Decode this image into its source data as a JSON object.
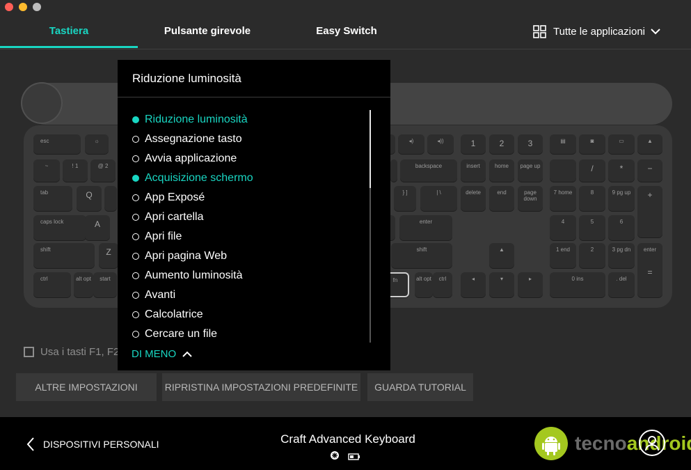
{
  "tabs": [
    {
      "label": "Tastiera"
    },
    {
      "label": "Pulsante girevole"
    },
    {
      "label": "Easy Switch"
    }
  ],
  "apps_label": "Tutte le applicazioni",
  "keys": {
    "esc": "esc",
    "backspace": "backspace",
    "insert": "insert",
    "home": "home",
    "pageup": "page up",
    "delete": "delete",
    "end": "end",
    "pagedown": "page down",
    "tab": "tab",
    "capslock": "caps lock",
    "shift_l": "shift",
    "shift_r": "shift",
    "enter": "enter",
    "ctrl_l": "ctrl",
    "ctrl_r": "ctrl",
    "alt": "alt opt",
    "alt_r": "alt opt",
    "start": "start",
    "fn": "fn",
    "q": "Q",
    "a": "A",
    "z": "Z",
    "tilde": "~",
    "one": "! 1",
    "two": "@ 2",
    "bracket": "} ]",
    "pipe": "| \\",
    "one_top": "1",
    "two_top": "2",
    "three_top": "3",
    "np7": "7 home",
    "np8": "8",
    "np9": "9 pg up",
    "np4": "4",
    "np5": "5",
    "np6": "6",
    "np1": "1 end",
    "np2": "2",
    "np3": "3 pg dn",
    "np0": "0 ins",
    "npdot": ". del",
    "npslash": "/",
    "npstar": "*",
    "npminus": "−",
    "npplus": "+",
    "npenter": "enter",
    "npequals": "="
  },
  "fn_check_label": "Usa i tasti F1, F2",
  "buttons": {
    "more": "ALTRE IMPOSTAZIONI",
    "reset": "RIPRISTINA IMPOSTAZIONI PREDEFINITE",
    "tutorial": "GUARDA TUTORIAL"
  },
  "footer": {
    "back_label": "DISPOSITIVI PERSONALI",
    "device_name": "Craft Advanced Keyboard"
  },
  "watermark": {
    "part1": "tecno",
    "part2": "android"
  },
  "dropdown": {
    "title": "Riduzione luminosità",
    "items": [
      {
        "label": "Riduzione luminosità",
        "selected": true
      },
      {
        "label": "Assegnazione tasto",
        "selected": false
      },
      {
        "label": "Avvia applicazione",
        "selected": false
      },
      {
        "label": "Acquisizione schermo",
        "selected": true
      },
      {
        "label": "App Exposé",
        "selected": false
      },
      {
        "label": "Apri cartella",
        "selected": false
      },
      {
        "label": "Apri file",
        "selected": false
      },
      {
        "label": "Apri pagina Web",
        "selected": false
      },
      {
        "label": "Aumento luminosità",
        "selected": false
      },
      {
        "label": "Avanti",
        "selected": false
      },
      {
        "label": "Calcolatrice",
        "selected": false
      },
      {
        "label": "Cercare un file",
        "selected": false
      }
    ],
    "less_label": "DI MENO"
  },
  "colors": {
    "accent": "#19d6c2",
    "background": "#2b2b2b",
    "footer": "#000000"
  }
}
